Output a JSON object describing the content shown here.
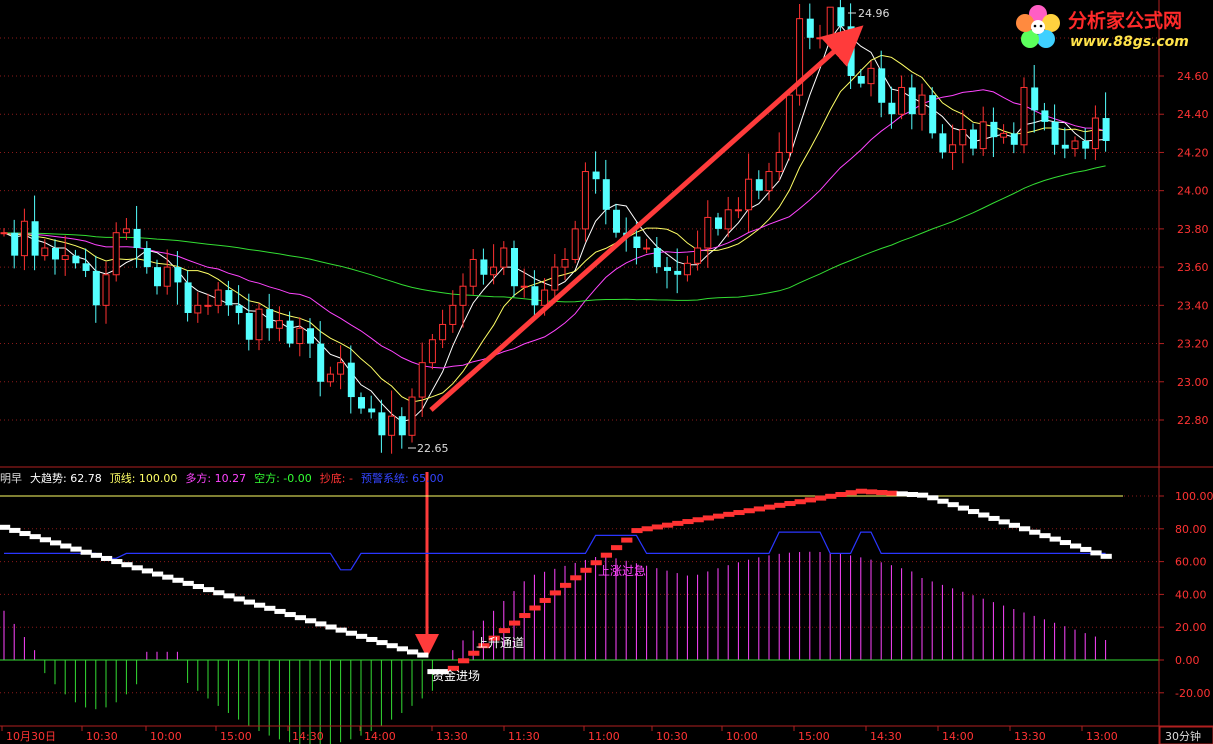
{
  "logo": {
    "title": "分析家公式网",
    "url": "www.88gs.com",
    "icon": "flower-icon"
  },
  "period_label": "30分钟",
  "time_axis": [
    "10月30日",
    "10:30",
    "10:00",
    "15:00",
    "14:30",
    "14:00",
    "13:30",
    "11:30",
    "11:00",
    "10:30",
    "10:00",
    "15:00",
    "14:30",
    "14:00",
    "13:30",
    "13:00"
  ],
  "indicator_header": [
    {
      "text": "明早",
      "color": "#dddddd"
    },
    {
      "text": "大趋势: 62.78",
      "color": "#ffffff"
    },
    {
      "text": "顶线: 100.00",
      "color": "#ffff66"
    },
    {
      "text": "多方: 10.27",
      "color": "#ff44ff"
    },
    {
      "text": "空方: -0.00",
      "color": "#33ff33"
    },
    {
      "text": "抄底: -",
      "color": "#ff3333"
    },
    {
      "text": "预警系统: 65.00",
      "color": "#3344ff"
    }
  ],
  "annotations": {
    "high": "24.96",
    "low": "22.65",
    "capital_in": "资金进场",
    "rise_channel": "上升通道",
    "rise_accel": "上涨过急"
  },
  "colors": {
    "up": "#ff3232",
    "down": "#54ffff",
    "ma5": "#ffffff",
    "ma10": "#ffff66",
    "ma20": "#ff44ff",
    "ma60": "#33dd33",
    "axis": "#b02020",
    "grid": "#8b1a1a"
  },
  "chart_data": [
    {
      "type": "candlestick",
      "title": "",
      "ylim": [
        22.6,
        25.05
      ],
      "y_ticks": [
        22.8,
        23.0,
        23.2,
        23.4,
        23.6,
        23.8,
        24.0,
        24.2,
        24.4,
        24.6
      ],
      "y_tick_labels": [
        "22.80",
        "23.00",
        "23.20",
        "23.40",
        "23.60",
        "23.80",
        "24.00",
        "24.20",
        "24.40",
        "24.60"
      ],
      "close_start": 23.78,
      "closes": [
        23.78,
        23.66,
        23.84,
        23.66,
        23.7,
        23.64,
        23.66,
        23.62,
        23.58,
        23.4,
        23.56,
        23.78,
        23.8,
        23.7,
        23.6,
        23.5,
        23.6,
        23.52,
        23.36,
        23.4,
        23.4,
        23.48,
        23.4,
        23.36,
        23.22,
        23.38,
        23.28,
        23.32,
        23.2,
        23.28,
        23.2,
        23.0,
        23.04,
        23.1,
        22.92,
        22.86,
        22.84,
        22.72,
        22.82,
        22.72,
        22.92,
        23.1,
        23.22,
        23.3,
        23.4,
        23.5,
        23.64,
        23.56,
        23.6,
        23.7,
        23.5,
        23.5,
        23.4,
        23.48,
        23.6,
        23.64,
        23.8,
        24.1,
        24.06,
        23.9,
        23.78,
        23.76,
        23.7,
        23.7,
        23.6,
        23.58,
        23.56,
        23.62,
        23.7,
        23.86,
        23.8,
        23.9,
        23.9,
        24.06,
        24.0,
        24.1,
        24.2,
        24.5,
        24.9,
        24.8,
        24.8,
        24.96,
        24.86,
        24.6,
        24.56,
        24.64,
        24.46,
        24.4,
        24.54,
        24.4,
        24.5,
        24.3,
        24.2,
        24.24,
        24.32,
        24.22,
        24.36,
        24.28,
        24.3,
        24.24,
        24.54,
        24.42,
        24.36,
        24.24,
        24.22,
        24.26,
        24.22,
        24.38,
        24.26
      ]
    },
    {
      "type": "line_bar",
      "title": "",
      "ylim": [
        -27,
        110
      ],
      "y_ticks": [
        -20,
        0,
        20,
        40,
        60,
        80,
        100
      ],
      "y_tick_labels": [
        "-20.00",
        "0.00",
        "20.00",
        "40.00",
        "60.00",
        "80.00",
        "100.00"
      ],
      "series": [
        {
          "name": "大趋势",
          "value": 62.78
        },
        {
          "name": "顶线",
          "value": 100.0
        },
        {
          "name": "多方",
          "value": 10.27
        },
        {
          "name": "空方",
          "value": -0.0
        },
        {
          "name": "预警系统",
          "value": 65.0
        }
      ]
    }
  ]
}
